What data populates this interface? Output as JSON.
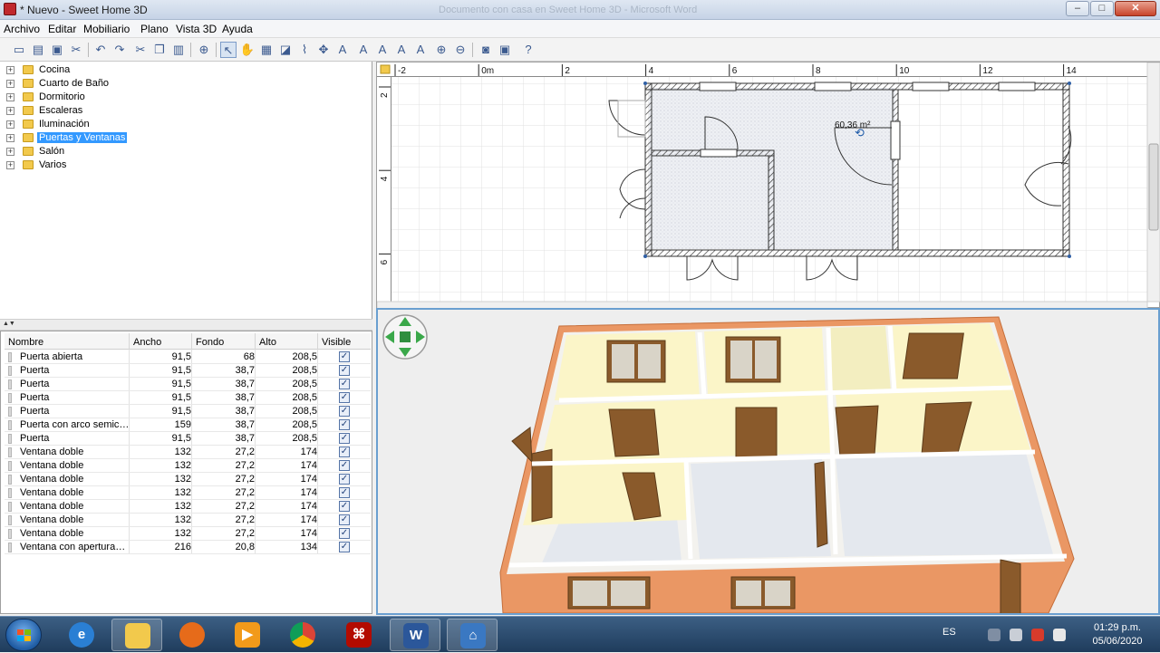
{
  "window": {
    "title": "* Nuevo - Sweet Home 3D",
    "background_title": "Documento con casa en Sweet Home 3D  -  Microsoft Word",
    "minimize_symbol": "–",
    "maximize_symbol": "□",
    "close_symbol": "✕"
  },
  "menu": [
    "Archivo",
    "Editar",
    "Mobiliario",
    "Plano",
    "Vista 3D",
    "Ayuda"
  ],
  "toolbar": {
    "icons": [
      "new-file-icon",
      "open-icon",
      "save-icon",
      "cut-icon",
      "undo-icon",
      "redo-icon",
      "cut-icon",
      "copy-icon",
      "paste-icon",
      "add-furniture-icon",
      "select-arrow-icon",
      "pan-hand-icon",
      "create-walls-icon",
      "create-rooms-icon",
      "create-polylines-icon",
      "create-dimensions-icon",
      "add-text-icon",
      "text-style-icon",
      "increase-text-icon",
      "decrease-text-icon",
      "bold-text-icon",
      "zoom-in-icon",
      "zoom-out-icon",
      "photo-camera-icon",
      "video-icon",
      "help-icon"
    ]
  },
  "catalog": {
    "items": [
      {
        "label": "Cocina",
        "selected": false
      },
      {
        "label": "Cuarto de Baño",
        "selected": false
      },
      {
        "label": "Dormitorio",
        "selected": false
      },
      {
        "label": "Escaleras",
        "selected": false
      },
      {
        "label": "Iluminación",
        "selected": false
      },
      {
        "label": "Puertas y Ventanas",
        "selected": true
      },
      {
        "label": "Salón",
        "selected": false
      },
      {
        "label": "Varios",
        "selected": false
      }
    ]
  },
  "furniture": {
    "columns": [
      "Nombre",
      "Ancho",
      "Fondo",
      "Alto",
      "Visible"
    ],
    "rows": [
      {
        "name": "Puerta abierta",
        "ancho": "91,5",
        "fondo": "68",
        "alto": "208,5",
        "visible": true
      },
      {
        "name": "Puerta",
        "ancho": "91,5",
        "fondo": "38,7",
        "alto": "208,5",
        "visible": true
      },
      {
        "name": "Puerta",
        "ancho": "91,5",
        "fondo": "38,7",
        "alto": "208,5",
        "visible": true
      },
      {
        "name": "Puerta",
        "ancho": "91,5",
        "fondo": "38,7",
        "alto": "208,5",
        "visible": true
      },
      {
        "name": "Puerta",
        "ancho": "91,5",
        "fondo": "38,7",
        "alto": "208,5",
        "visible": true
      },
      {
        "name": "Puerta con arco semic…",
        "ancho": "159",
        "fondo": "38,7",
        "alto": "208,5",
        "visible": true
      },
      {
        "name": "Puerta",
        "ancho": "91,5",
        "fondo": "38,7",
        "alto": "208,5",
        "visible": true
      },
      {
        "name": "Ventana doble",
        "ancho": "132",
        "fondo": "27,2",
        "alto": "174",
        "visible": true
      },
      {
        "name": "Ventana doble",
        "ancho": "132",
        "fondo": "27,2",
        "alto": "174",
        "visible": true
      },
      {
        "name": "Ventana doble",
        "ancho": "132",
        "fondo": "27,2",
        "alto": "174",
        "visible": true
      },
      {
        "name": "Ventana doble",
        "ancho": "132",
        "fondo": "27,2",
        "alto": "174",
        "visible": true
      },
      {
        "name": "Ventana doble",
        "ancho": "132",
        "fondo": "27,2",
        "alto": "174",
        "visible": true
      },
      {
        "name": "Ventana doble",
        "ancho": "132",
        "fondo": "27,2",
        "alto": "174",
        "visible": true
      },
      {
        "name": "Ventana doble",
        "ancho": "132",
        "fondo": "27,2",
        "alto": "174",
        "visible": true
      },
      {
        "name": "Ventana con apertura…",
        "ancho": "216",
        "fondo": "20,8",
        "alto": "134",
        "visible": true
      }
    ]
  },
  "plan": {
    "ruler_x": [
      "-2",
      "0m",
      "2",
      "4",
      "6",
      "8",
      "10",
      "12",
      "14"
    ],
    "ruler_y": [
      "2",
      "4",
      "6"
    ],
    "room_area": "60,36 m²"
  },
  "taskbar": {
    "apps": [
      "internet-explorer-icon",
      "file-explorer-icon",
      "firefox-icon",
      "media-player-icon",
      "chrome-icon",
      "acrobat-icon",
      "word-icon",
      "sweet-home-3d-icon"
    ],
    "language": "ES",
    "time": "01:29 p.m.",
    "date": "05/06/2020"
  },
  "colors": {
    "selection": "#3399ff",
    "wall_hatch": "#333333",
    "wall_3d": "#e89060",
    "wall_inner": "#fbf6c9"
  }
}
